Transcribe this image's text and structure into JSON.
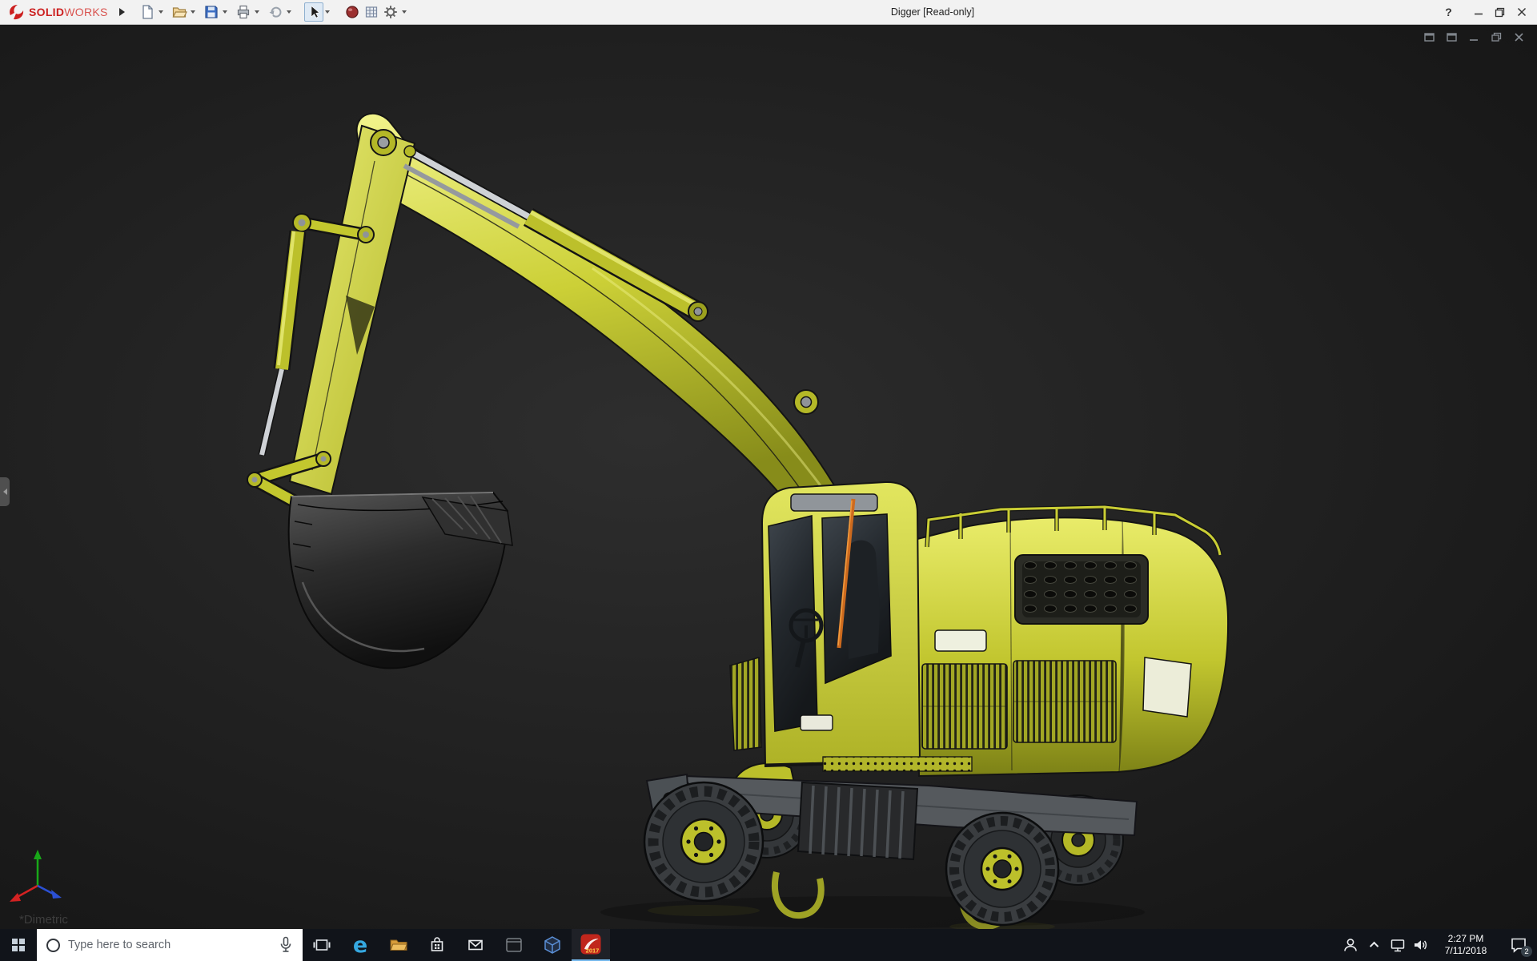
{
  "titlebar": {
    "brand": {
      "solid": "SOLID",
      "works": "WORKS"
    },
    "title": "Digger [Read-only]",
    "controls": {
      "help": "?"
    }
  },
  "toolbar_icons": [
    "new-document",
    "open",
    "save",
    "print",
    "undo",
    "select-arrow",
    "appearance",
    "evaluate",
    "options-gear"
  ],
  "viewport": {
    "orientation_label": "*Dimetric"
  },
  "taskbar": {
    "search_placeholder": "Type here to search",
    "edge_glyph": "e",
    "solidworks_year": "2017",
    "tray": {
      "time": "2:27 PM",
      "date": "7/11/2018",
      "notification_count": "2"
    }
  },
  "colors": {
    "machine_yellow": "#c6ca30",
    "brand_red": "#cc1f1f",
    "titlebar_bg": "#f2f2f2",
    "viewport_bg": "#1f1f1f",
    "taskbar_bg": "#11141a",
    "taskbar_accent": "#76b9ed"
  }
}
